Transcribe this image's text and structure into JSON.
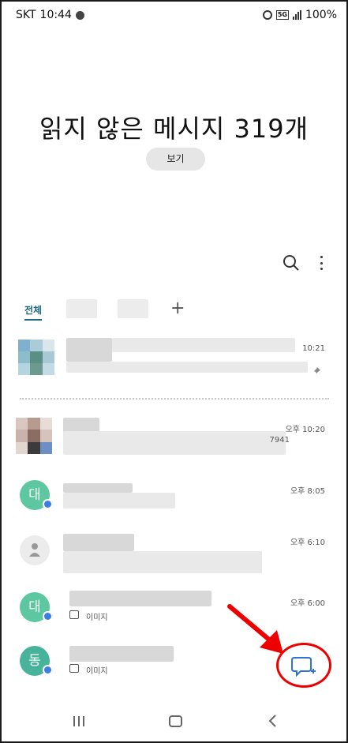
{
  "status_bar": {
    "carrier": "SKT",
    "time": "10:44",
    "network": "5G",
    "battery": "100%"
  },
  "header": {
    "title": "읽지 않은 메시지 319개",
    "view_button": "보기"
  },
  "toolbar": {
    "search_icon": "search-icon",
    "more_icon": "more-vertical-icon"
  },
  "tabs": {
    "all": "전체",
    "add": "+"
  },
  "conversations": [
    {
      "time": "10:21",
      "pinned": true
    },
    {
      "time": "오후 10:20",
      "preview_fragment": "7941"
    },
    {
      "time": "오후 8:05",
      "avatar_initial": "대"
    },
    {
      "time": "오후 6:10",
      "avatar_initial": ""
    },
    {
      "time": "오후 6:00",
      "avatar_initial": "대",
      "attachment_label": "이미지"
    },
    {
      "avatar_initial": "동",
      "attachment_label": "이미지"
    }
  ],
  "fab": {
    "icon": "new-chat-icon"
  },
  "colors": {
    "accent": "#1d6a7e",
    "badge": "#3b7de6",
    "annotation": "#e00000",
    "avatar_green": "#5cc7a0"
  }
}
